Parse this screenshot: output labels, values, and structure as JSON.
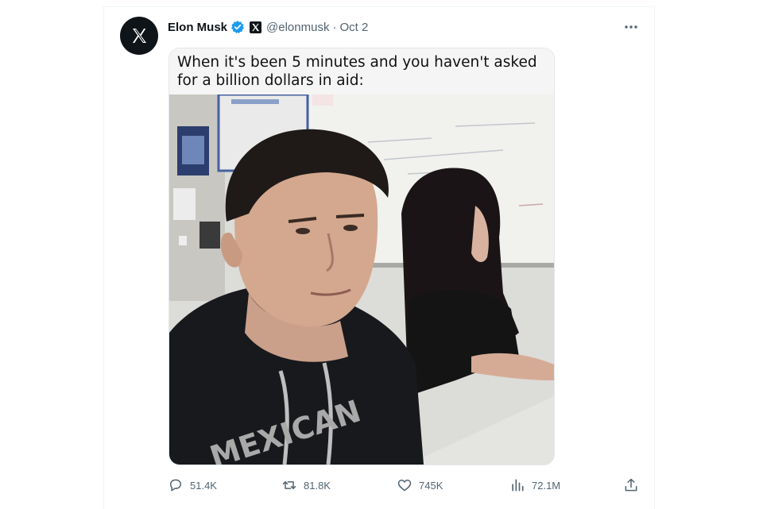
{
  "tweet": {
    "author_name": "Elon Musk",
    "handle": "@elonmusk",
    "separator": "·",
    "date": "Oct 2",
    "media_caption": "When it's been 5 minutes and you haven't asked for a billion dollars in aid:"
  },
  "meme_shirt_text": "MEXICAN",
  "actions": {
    "replies": "51.4K",
    "reposts": "81.8K",
    "likes": "745K",
    "views": "72.1M"
  },
  "icons": [
    "x-logo-icon",
    "verified-badge-icon",
    "x-affiliate-badge-icon",
    "more-icon",
    "reply-icon",
    "repost-icon",
    "like-icon",
    "views-icon",
    "share-icon"
  ],
  "colors": {
    "text_primary": "#0f1419",
    "text_secondary": "#536471",
    "verified_blue": "#1d9bf0"
  }
}
